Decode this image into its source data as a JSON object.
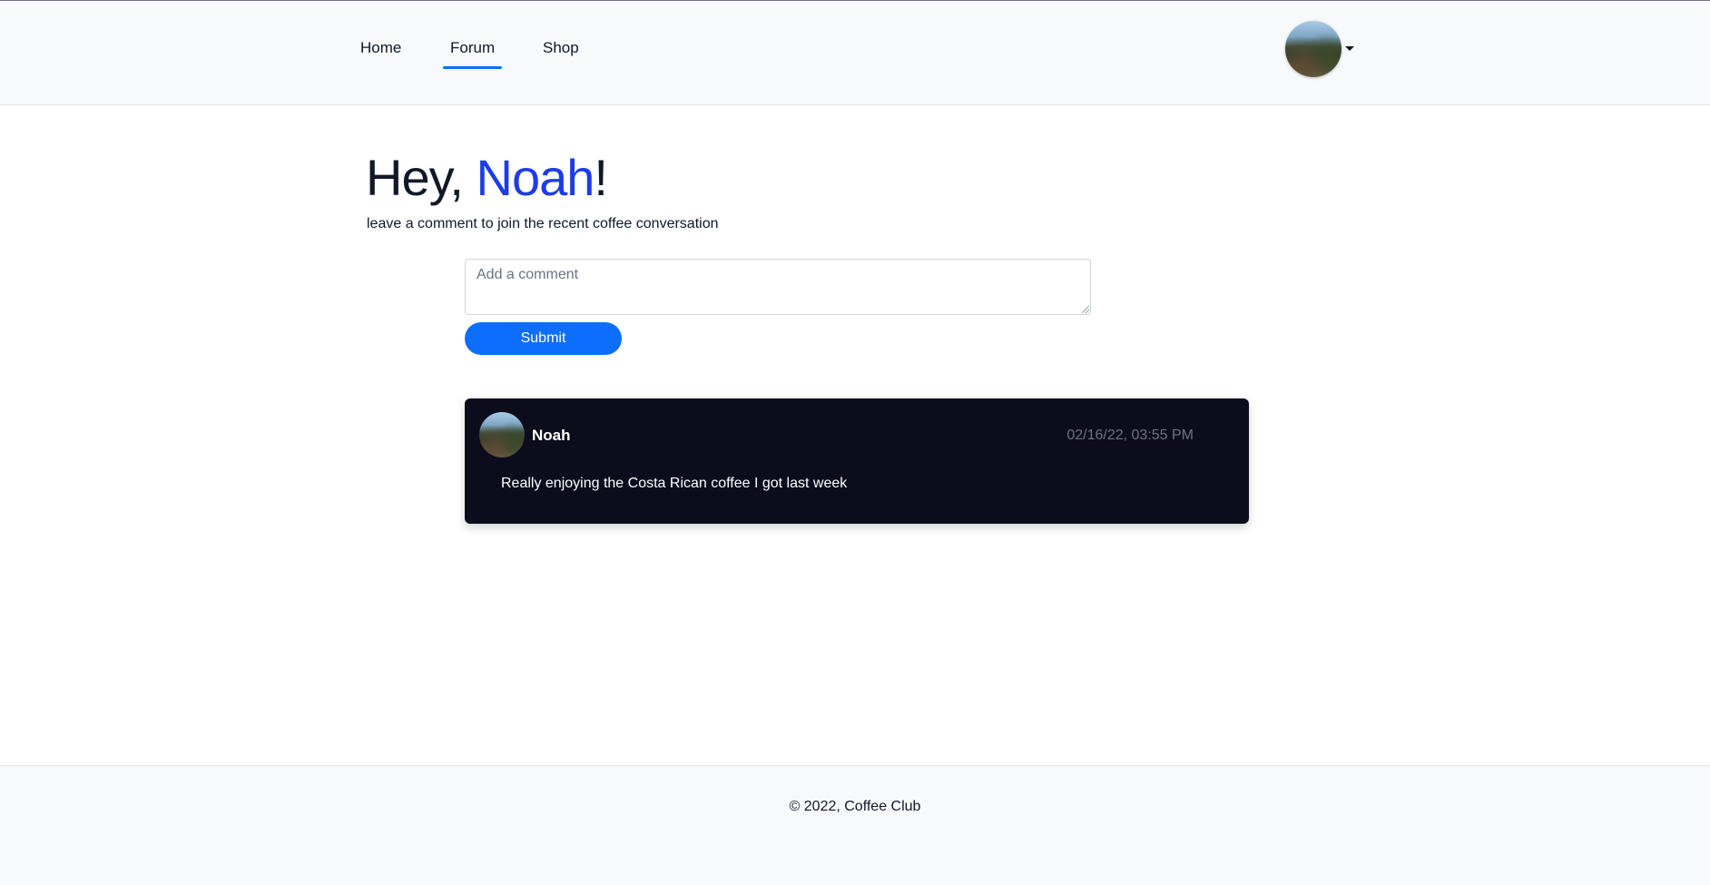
{
  "nav": {
    "items": [
      {
        "label": "Home",
        "active": false
      },
      {
        "label": "Forum",
        "active": true
      },
      {
        "label": "Shop",
        "active": false
      }
    ],
    "active_color": "#0d6efd"
  },
  "user_menu": {
    "avatar_icon": "profile-avatar-mountain-photo",
    "caret_icon": "chevron-down-icon"
  },
  "greeting": {
    "prefix": "Hey, ",
    "name": "Noah",
    "suffix": "!",
    "name_color": "#1d3ce8",
    "subtitle": "leave a comment to join the recent coffee conversation"
  },
  "comment_form": {
    "placeholder": "Add a comment",
    "value": "",
    "submit_label": "Submit",
    "button_color": "#0d6efd"
  },
  "comments": [
    {
      "author": "Noah",
      "timestamp": "02/16/22, 03:55 PM",
      "text": "Really enjoying the Costa Rican coffee I got last week"
    }
  ],
  "footer": {
    "text": "© 2022, Coffee Club"
  }
}
